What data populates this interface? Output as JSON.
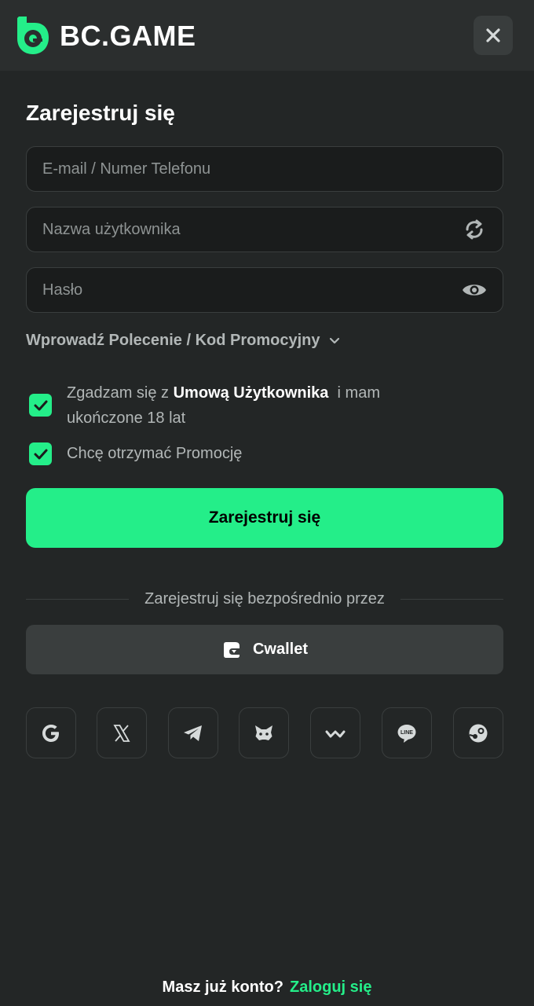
{
  "header": {
    "logo_text": "BC.GAME",
    "close_label": "×"
  },
  "form": {
    "title": "Zarejestruj się",
    "email_placeholder": "E-mail / Numer Telefonu",
    "username_placeholder": "Nazwa użytkownika",
    "password_placeholder": "Hasło",
    "promo_toggle_label": "Wprowadź Polecenie / Kod Promocyjny",
    "terms_prefix": "Zgadzam się z ",
    "terms_link": "Umową Użytkownika",
    "terms_suffix": "  i mam ukończone 18 lat",
    "promo_consent_label": "Chcę otrzymać Promocję",
    "submit_label": "Zarejestruj się"
  },
  "alt_signup": {
    "divider_text": "Zarejestruj się bezpośrednio przez",
    "cwallet_label": "Cwallet",
    "social_icons": [
      "google-icon",
      "x-icon",
      "telegram-icon",
      "metamask-icon",
      "walletconnect-icon",
      "line-icon",
      "steam-icon"
    ]
  },
  "footer": {
    "question": "Masz już konto?",
    "login_link": "Zaloguj się"
  },
  "colors": {
    "accent": "#24ee89",
    "background": "#232626",
    "header": "#2b2e2e",
    "input_bg": "#1a1c1c",
    "muted_text": "#b2b7b7"
  }
}
